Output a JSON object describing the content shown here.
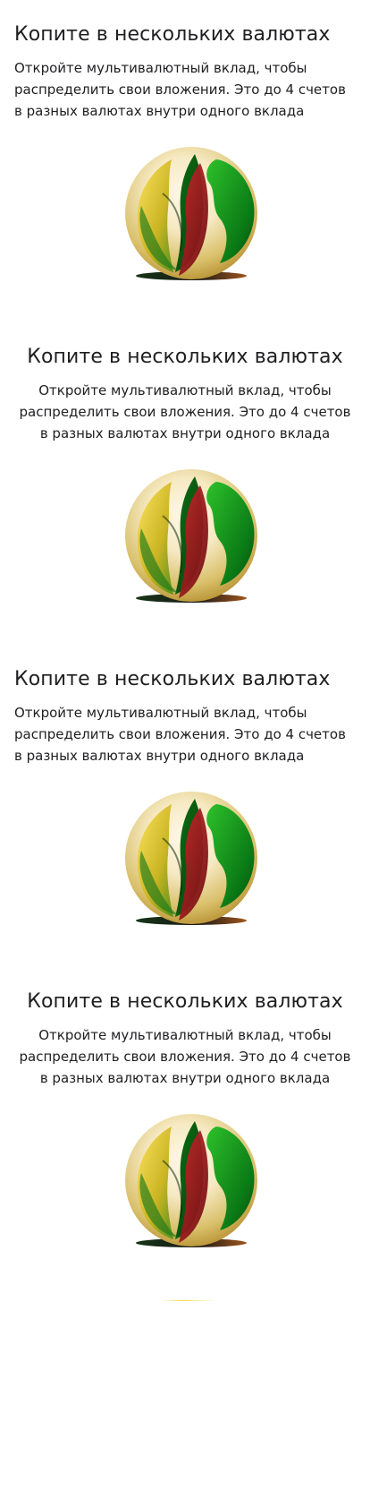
{
  "sections": [
    {
      "title": "Копите в нескольких валютах",
      "description": "Откройте мультивалютный вклад, чтобы распределить свои вложения. Это до 4 счетов в разных валютах внутри одного вклада",
      "align": "left",
      "illustration": "multicurrency-globe-leaves-icon"
    },
    {
      "title": "Копите в нескольких валютах",
      "description": "Откройте мультивалютный вклад, чтобы распределить свои вложения. Это до 4 счетов в разных валютах внутри одного вклада",
      "align": "center",
      "illustration": "multicurrency-globe-leaves-icon"
    },
    {
      "title": "Копите в нескольких валютах",
      "description": "Откройте мультивалютный вклад, чтобы распределить свои вложения. Это до 4 счетов в разных валютах внутри одного вклада",
      "align": "left",
      "illustration": "multicurrency-globe-leaves-icon"
    },
    {
      "title": "Копите в нескольких валютах",
      "description": "Откройте мультивалютный вклад, чтобы распределить свои вложения. Это до 4 счетов в разных валютах внутри одного вклада",
      "align": "center",
      "illustration": "multicurrency-globe-leaves-icon"
    }
  ],
  "colors": {
    "background": "#ffffff",
    "text": "#1f1f22",
    "green_dark": "#0a5f14",
    "green": "#22a21f",
    "yellow": "#f1d42a",
    "cream": "#f6e9c2",
    "brown": "#7b4a12",
    "red": "#a7171d"
  }
}
